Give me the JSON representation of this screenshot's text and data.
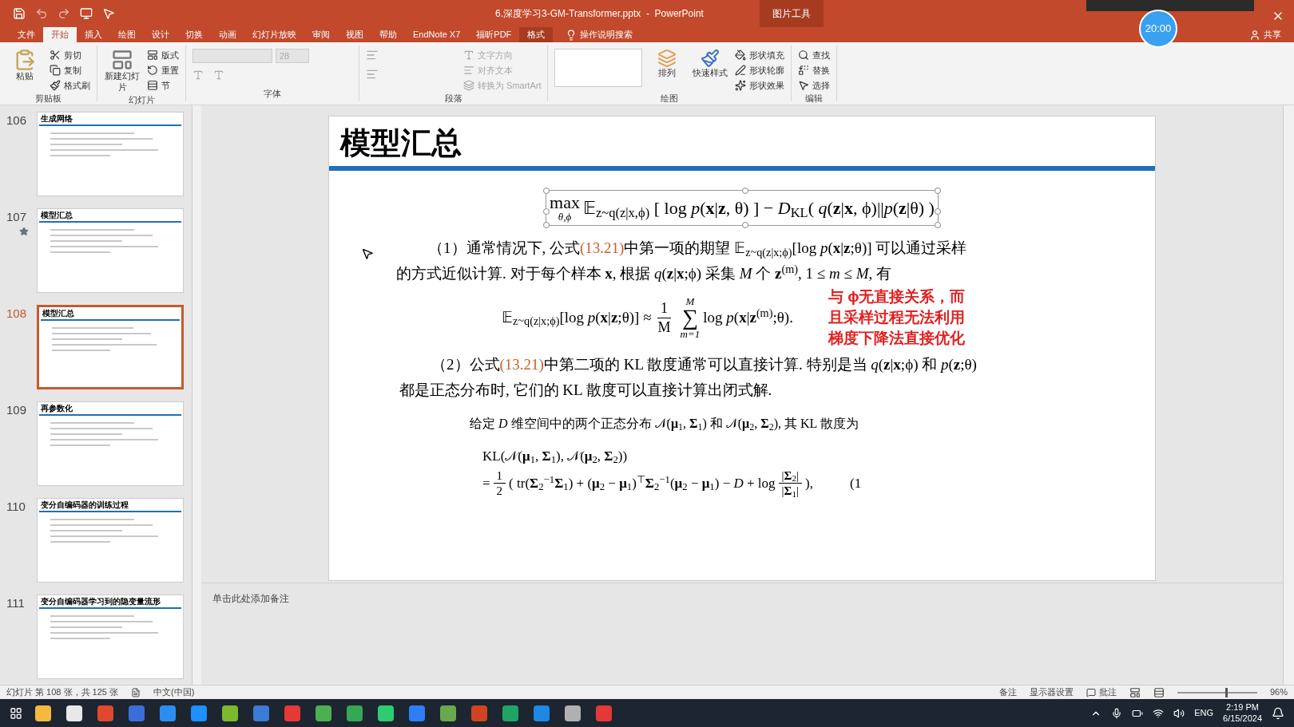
{
  "window": {
    "title": "6.深度学习3-GM-Transformer.pptx  -  PowerPoint",
    "context_label": "图片工具"
  },
  "ribbon_tabs": [
    {
      "label": "文件",
      "selected": false,
      "kind": "normal"
    },
    {
      "label": "开始",
      "selected": true,
      "kind": "normal"
    },
    {
      "label": "插入",
      "selected": false,
      "kind": "normal"
    },
    {
      "label": "绘图",
      "selected": false,
      "kind": "normal"
    },
    {
      "label": "设计",
      "selected": false,
      "kind": "normal"
    },
    {
      "label": "切换",
      "selected": false,
      "kind": "normal"
    },
    {
      "label": "动画",
      "selected": false,
      "kind": "normal"
    },
    {
      "label": "幻灯片放映",
      "selected": false,
      "kind": "normal"
    },
    {
      "label": "审阅",
      "selected": false,
      "kind": "normal"
    },
    {
      "label": "视图",
      "selected": false,
      "kind": "normal"
    },
    {
      "label": "帮助",
      "selected": false,
      "kind": "normal"
    },
    {
      "label": "EndNote X7",
      "selected": false,
      "kind": "normal"
    },
    {
      "label": "福昕PDF",
      "selected": false,
      "kind": "normal"
    },
    {
      "label": "格式",
      "selected": false,
      "kind": "context"
    }
  ],
  "tell_me": "操作说明搜索",
  "share": "共享",
  "timer": "20:00",
  "ribbon_groups": [
    {
      "label": "剪贴板",
      "big": {
        "label": "粘贴",
        "disabled": false
      },
      "items": [
        {
          "label": "剪切",
          "disabled": false
        },
        {
          "label": "复制",
          "disabled": false
        },
        {
          "label": "格式刷",
          "disabled": false
        }
      ]
    },
    {
      "label": "幻灯片",
      "big": {
        "label": "新建幻灯片",
        "disabled": false
      },
      "items": [
        {
          "label": "版式",
          "disabled": false
        },
        {
          "label": "重置",
          "disabled": false
        },
        {
          "label": "节",
          "disabled": false
        }
      ]
    },
    {
      "label": "字体",
      "font_size": "28"
    },
    {
      "label": "段落",
      "items": [
        {
          "label": "文字方向",
          "disabled": true
        },
        {
          "label": "对齐文本",
          "disabled": true
        },
        {
          "label": "转换为 SmartArt",
          "disabled": true
        }
      ]
    },
    {
      "label": "绘图",
      "big": {
        "label": "排列",
        "disabled": false
      },
      "big2": {
        "label": "快速样式",
        "disabled": false
      },
      "items": [
        {
          "label": "形状填充",
          "disabled": false
        },
        {
          "label": "形状轮廓",
          "disabled": false
        },
        {
          "label": "形状效果",
          "disabled": false
        }
      ]
    },
    {
      "label": "编辑",
      "items": [
        {
          "label": "查找",
          "disabled": false
        },
        {
          "label": "替换",
          "disabled": false
        },
        {
          "label": "选择",
          "disabled": false
        }
      ]
    }
  ],
  "thumbnails": [
    {
      "number": "106",
      "title": "生成网络",
      "selected": false,
      "starred": false
    },
    {
      "number": "107",
      "title": "模型汇总",
      "selected": false,
      "starred": true
    },
    {
      "number": "108",
      "title": "模型汇总",
      "selected": true,
      "starred": false
    },
    {
      "number": "109",
      "title": "再参数化",
      "selected": false,
      "starred": false
    },
    {
      "number": "110",
      "title": "变分自编码器的训练过程",
      "selected": false,
      "starred": false
    },
    {
      "number": "111",
      "title": "变分自编码器学习到的隐变量流形",
      "selected": false,
      "starred": false
    }
  ],
  "slide": {
    "title": "模型汇总",
    "main_formula": {
      "op": "max",
      "op_sub": "θ,ϕ",
      "body": "𝔼$_{z~q(z|x,ϕ)}$ [ log *p*(**x**|**z**, θ) ] − *D*$_{KL}$( *q*(**z**|**x**, ϕ)||*p*(**z**|θ) )"
    },
    "paragraph_1": [
      {
        "kind": "text",
        "text": "（1）通常情况下, 公式"
      },
      {
        "kind": "ref",
        "text": "(13.21)"
      },
      {
        "kind": "text",
        "text": "中第一项的期望 𝔼$_{z~q(z|x;ϕ)}$[log *p*(**x**|**z**;θ)] 可以通过采样的方式近似计算. 对于每个样本 **x**, 根据 *q*(**z**|**x**;ϕ) 采集 *M* 个 **z**$^{(m)}$, 1 ≤ *m* ≤ *M*, 有"
      }
    ],
    "equation_1": {
      "lhs": "𝔼$_{z~q(z|x;ϕ)}$[log *p*(**x**|**z**;θ)] ≈",
      "num": "1",
      "den": "M",
      "sum_top": "M",
      "sum": "∑",
      "sum_bottom": "m=1",
      "rhs": "log *p*(**x**|**z**$^{(m)}$;θ)."
    },
    "note": [
      "与 ϕ无直接关系，而",
      "且采样过程无法利用",
      "梯度下降法直接优化"
    ],
    "paragraph_2": [
      {
        "kind": "text",
        "text": "（2）公式"
      },
      {
        "kind": "ref",
        "text": "(13.21)"
      },
      {
        "kind": "text",
        "text": "中第二项的 KL 散度通常可以直接计算. 特别是当 *q*(**z**|**x**;ϕ) 和 *p*(**z**;θ) 都是正态分布时, 它们的 KL 散度可以直接计算出闭式解."
      }
    ],
    "paragraph_3": "给定 *D* 维空间中的两个正态分布 𝒩(**μ**$_{1}$, **Σ**$_{1}$) 和 𝒩(**μ**$_{2}$, **Σ**$_{2}$), 其 KL 散度为",
    "kl_line": "KL(𝒩(**μ**$_{1}$, **Σ**$_{1}$), 𝒩(**μ**$_{2}$, **Σ**$_{2}$))",
    "kl_result": {
      "prefix": "=",
      "num": "1",
      "den": "2",
      "body": "( tr(**Σ**$_{2}$$^{−1}$**Σ**$_{1}$) + (**μ**$_{2}$ − **μ**$_{1}$)$^{⊤}$**Σ**$_{2}$$^{−1}$(**μ**$_{2}$ − **μ**$_{1}$) − *D* + log",
      "log_num": "|**Σ**$_{2}$|",
      "log_den": "|**Σ**$_{1}$|",
      "suffix": "),",
      "eq_number": "(1"
    }
  },
  "notes_placeholder": "单击此处添加备注",
  "status_bar": {
    "slide_info": "幻灯片 第 108 张，共 125 张",
    "language": "中文(中国)",
    "notes": "备注",
    "display": "显示器设置",
    "comments": "批注",
    "zoom": "96%",
    "zoom_slider": {
      "level": 0.6
    }
  },
  "taskbar": {
    "language": "ENG",
    "time": "2:19 PM",
    "date": "6/15/2024"
  }
}
